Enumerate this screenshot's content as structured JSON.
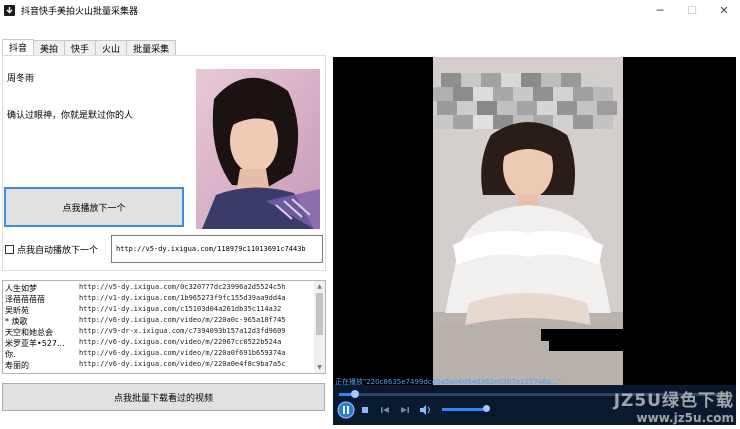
{
  "window": {
    "title": "抖音快手美拍火山批量采集器",
    "minimize": "─",
    "maximize": "☐",
    "close": "✕"
  },
  "tabs": [
    {
      "label": "抖音",
      "active": true
    },
    {
      "label": "美拍",
      "active": false
    },
    {
      "label": "快手",
      "active": false
    },
    {
      "label": "火山",
      "active": false
    },
    {
      "label": "批量采集",
      "active": false
    }
  ],
  "video_info": {
    "author": "周冬雨",
    "description": "确认过眼神，你就是默过你的人"
  },
  "controls": {
    "play_next_label": "点我播放下一个",
    "auto_play_label": "点我自动播放下一个",
    "auto_play_checked": false,
    "url_value": "http://v5-dy.ixigua.com/118979c11013691c7443b",
    "batch_download_label": "点我批量下载看过的视频"
  },
  "history": {
    "rows": [
      {
        "name": "人生如梦",
        "url": "http://v5-dy.ixigua.com/0c320777dc23996a2d5524c5h"
      },
      {
        "name": "泽蓓蓓蓓蓓",
        "url": "http://v1-dy.ixigua.com/1b965273f9fc155d39aa9dd4a"
      },
      {
        "name": "吴昕苑",
        "url": "http://v1-dy.ixigua.com/c15103d04a261db35c114a32"
      },
      {
        "name": "* 焕歌",
        "url": "http://v6-dy.ixigua.com/video/m/220a0c-965a18f745"
      },
      {
        "name": "天空和她总会",
        "url": "http://v9-dr-x.ixigua.com/c7394093b157a12d3fd9609"
      },
      {
        "name": "米罗亚羊•527...",
        "url": "http://v6-dy.ixigua.com/video/m/22067cc0522b524a"
      },
      {
        "name": "你.",
        "url": "http://v6-dy.ixigua.com/video/m/220a0f691b659374a"
      },
      {
        "name": "寿丽的",
        "url": "http://v6-dy.ixigua.com/video/m/220a0e4f8c9ba7a5c"
      }
    ],
    "scroll_up": "▲",
    "scroll_down": "▼"
  },
  "player": {
    "status": "正在播放\"220c8635e7499dc46a5a06d64d362e03b7a115746a...\"",
    "progress": 0.04,
    "volume": 0.95,
    "watermark_line1": "JZ5U绿色下载",
    "watermark_line2": "www.jz5u.com"
  },
  "colors": {
    "accent": "#3c8fd6",
    "player_bar": "#0a1a2e",
    "status_text": "#4f9cff"
  }
}
